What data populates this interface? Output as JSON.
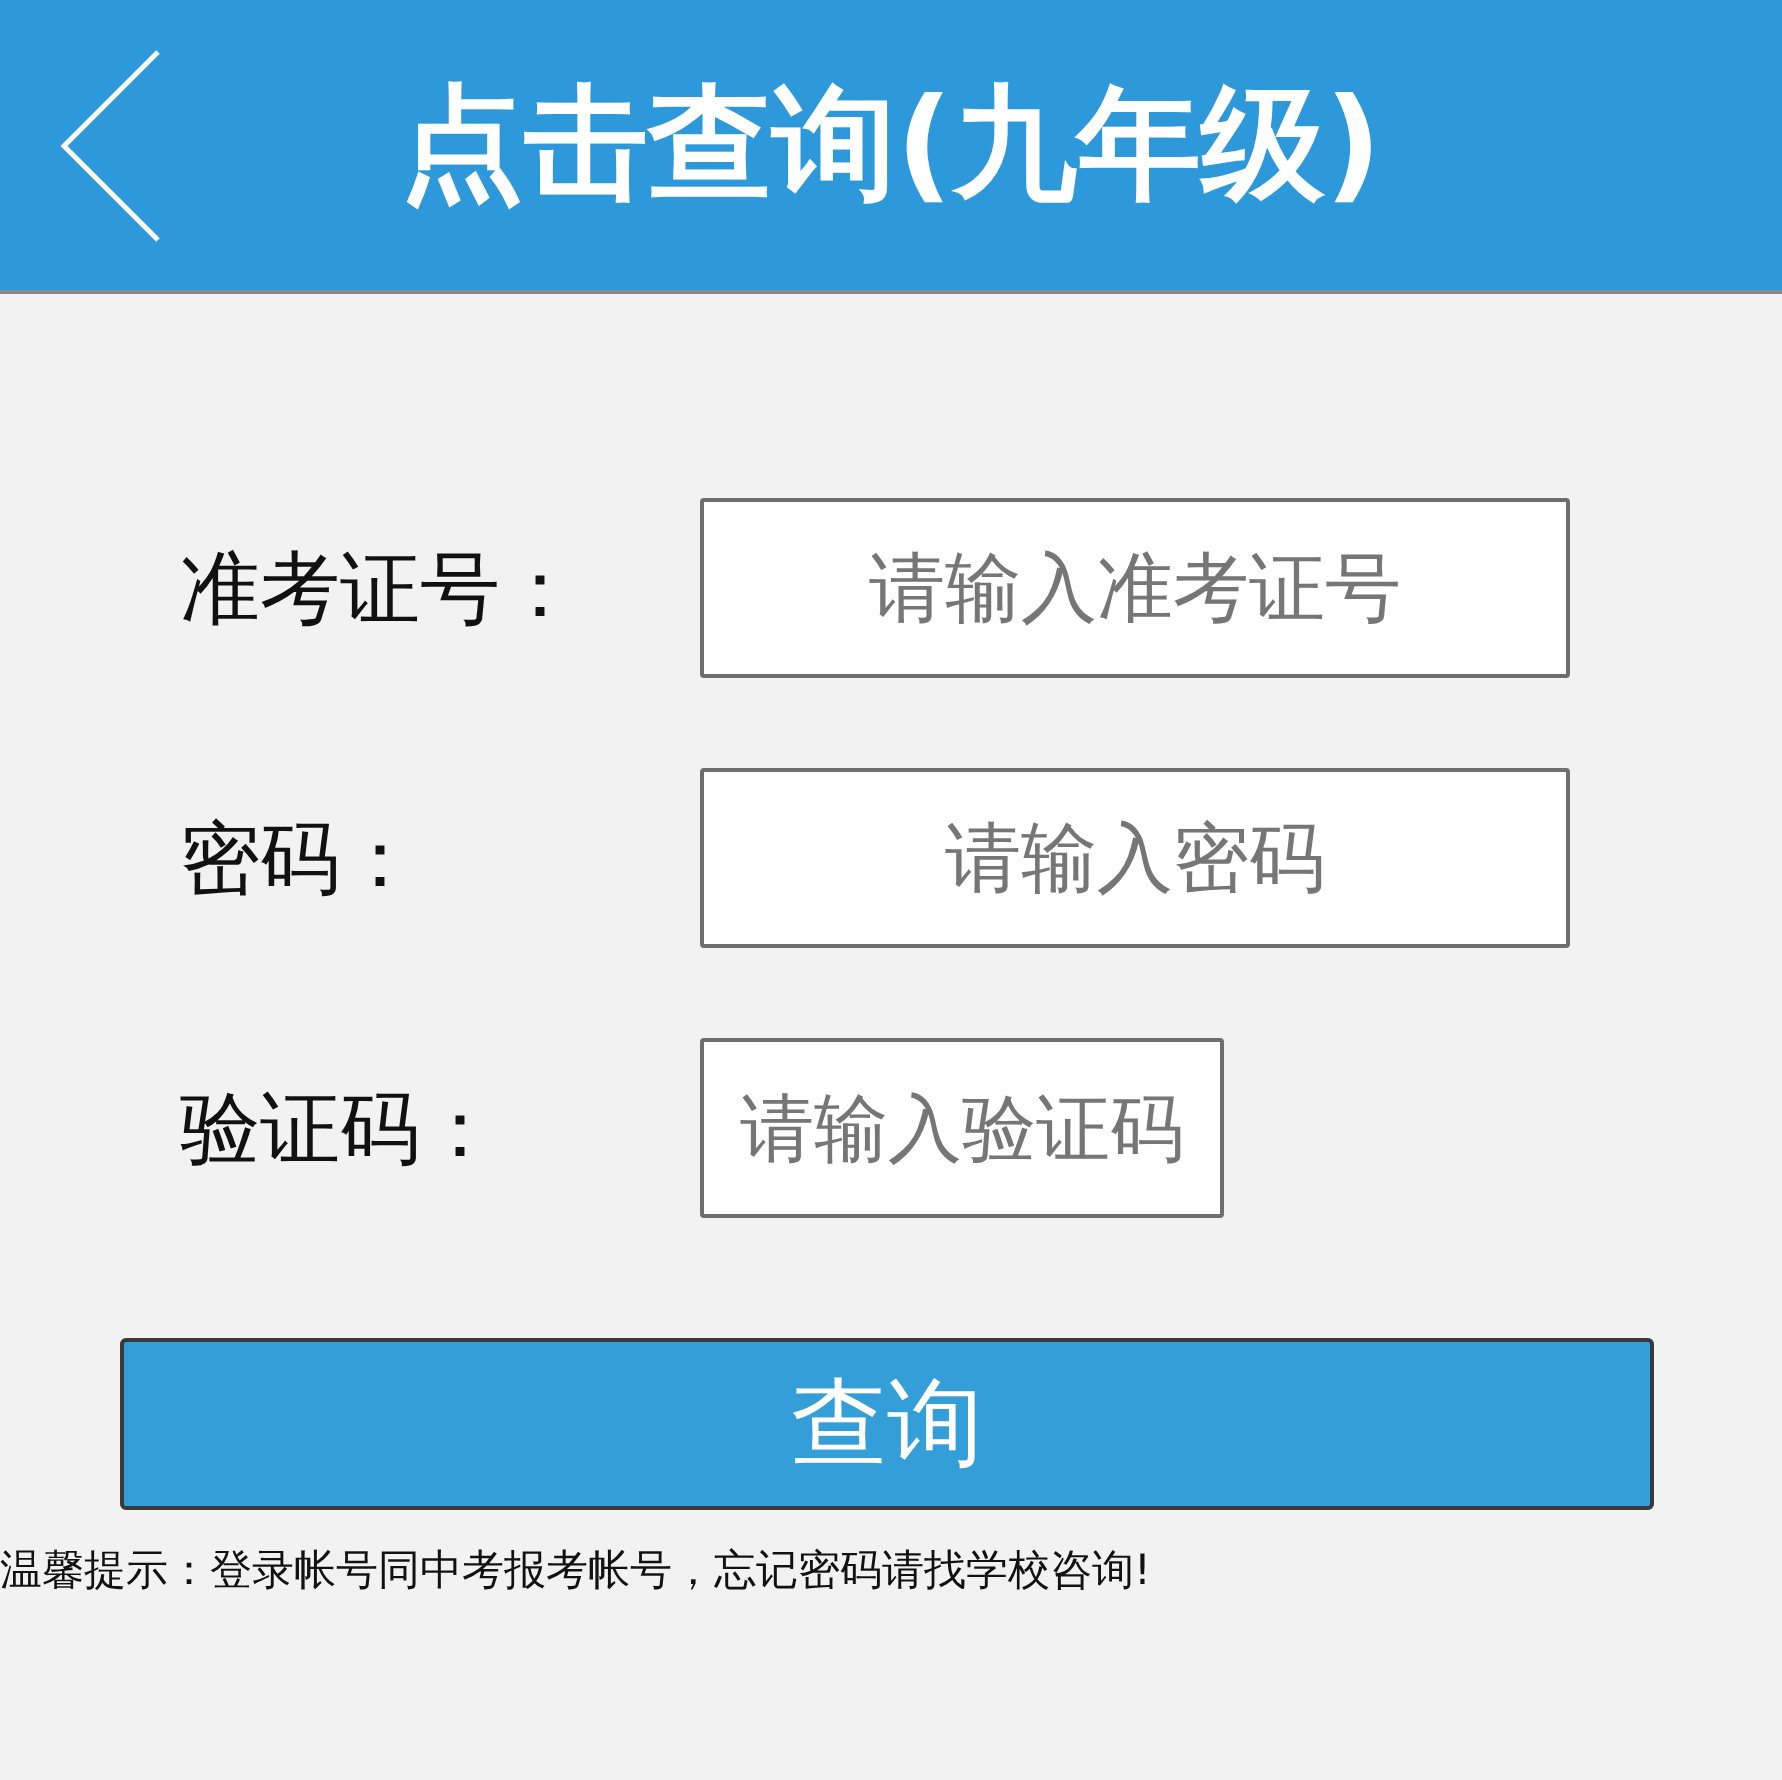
{
  "header": {
    "title": "点击查询(九年级)"
  },
  "form": {
    "fields": [
      {
        "kind": "text",
        "label": "准考证号：",
        "placeholder": "请输入准考证号"
      },
      {
        "kind": "password",
        "label": "密码：",
        "placeholder": "请输入密码"
      },
      {
        "kind": "captcha",
        "label": "验证码：",
        "placeholder": "请输入验证码"
      }
    ],
    "submit": "查询"
  },
  "tip": "温馨提示：登录帐号同中考报考帐号，忘记密码请找学校咨询!"
}
